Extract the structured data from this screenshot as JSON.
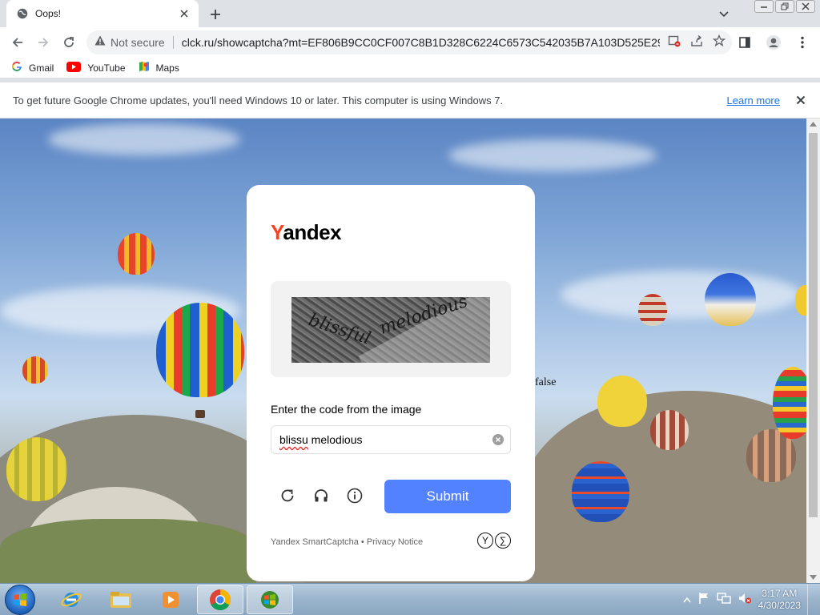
{
  "browser": {
    "tab_title": "Oops!",
    "security_label": "Not secure",
    "url": "clck.ru/showcaptcha?mt=EF806B9CC0CF007C8B1D328C6224C6573C542035B7A103D525E294...",
    "bookmarks": [
      {
        "label": "Gmail",
        "icon": "google-icon"
      },
      {
        "label": "YouTube",
        "icon": "youtube-icon"
      },
      {
        "label": "Maps",
        "icon": "maps-icon"
      }
    ],
    "infobar_message": "To get future Google Chrome updates, you'll need Windows 10 or later. This computer is using Windows 7.",
    "infobar_link": "Learn more"
  },
  "page": {
    "stray_text": "false",
    "logo_first": "Y",
    "logo_rest": "andex",
    "captcha_words": [
      "blissful",
      "melodious"
    ],
    "prompt": "Enter the code from the image",
    "input_value_misspelled": "blissu",
    "input_value_rest": " melodious",
    "submit_label": "Submit",
    "footer": "Yandex SmartCaptcha • Privacy Notice"
  },
  "taskbar": {
    "time": "3:17 AM",
    "date": "4/30/2023"
  },
  "colors": {
    "yandex_red": "#fc3f1d",
    "submit_blue": "#5282ff",
    "link_blue": "#1a73e8"
  }
}
